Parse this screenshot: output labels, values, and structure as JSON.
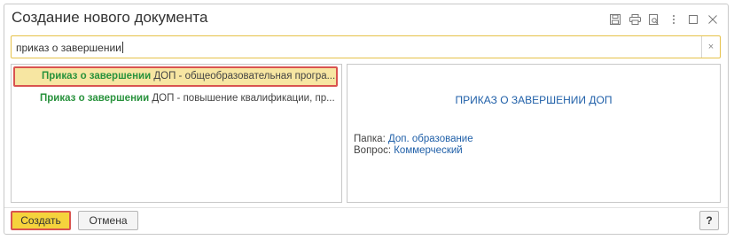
{
  "window": {
    "title": "Создание нового документа"
  },
  "toolbar_icons": [
    "save-icon",
    "print-icon",
    "preview-icon",
    "more-icon",
    "maximize-icon",
    "close-icon"
  ],
  "search": {
    "value": "приказ о завершении",
    "clear_label": "×"
  },
  "results": [
    {
      "highlight": "Приказ о завершении",
      "rest": " ДОП - общеобразовательная програ...",
      "selected": true
    },
    {
      "highlight": "Приказ о завершении",
      "rest": " ДОП - повышение квалификации, пр...",
      "selected": false
    }
  ],
  "preview": {
    "title": "ПРИКАЗ О ЗАВЕРШЕНИИ ДОП",
    "folder_label": "Папка:",
    "folder_value": "Доп. образование",
    "question_label": "Вопрос:",
    "question_value": "Коммерческий"
  },
  "buttons": {
    "create": "Создать",
    "cancel": "Отмена",
    "help": "?"
  },
  "colors": {
    "highlight_text": "#28923c",
    "link": "#1f5fa8",
    "selection": "#f7e6a2",
    "accent_border": "#d9534f",
    "primary_button": "#f5d33c"
  }
}
